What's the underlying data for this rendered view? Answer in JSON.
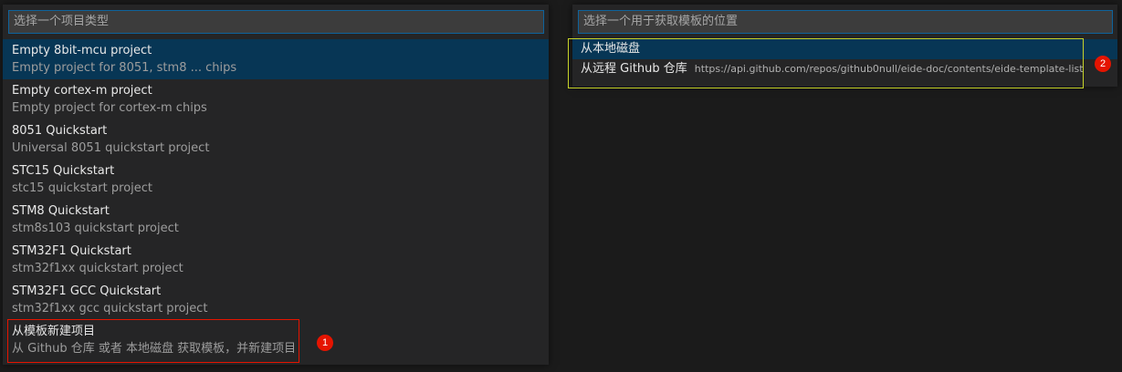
{
  "left_picker": {
    "placeholder": "选择一个项目类型",
    "items": [
      {
        "label": "Empty 8bit-mcu project",
        "description": "Empty project for 8051, stm8 ... chips"
      },
      {
        "label": "Empty cortex-m project",
        "description": "Empty project for cortex-m chips"
      },
      {
        "label": "8051 Quickstart",
        "description": "Universal 8051 quickstart project"
      },
      {
        "label": "STC15 Quickstart",
        "description": "stc15 quickstart project"
      },
      {
        "label": "STM8 Quickstart",
        "description": "stm8s103 quickstart project"
      },
      {
        "label": "STM32F1 Quickstart",
        "description": "stm32f1xx quickstart project"
      },
      {
        "label": "STM32F1 GCC Quickstart",
        "description": "stm32f1xx gcc quickstart project"
      },
      {
        "label": "从模板新建项目",
        "description": "从 Github 仓库 或者 本地磁盘 获取模板，并新建项目"
      }
    ]
  },
  "right_picker": {
    "placeholder": "选择一个用于获取模板的位置",
    "items": [
      {
        "label": "从本地磁盘",
        "detail": ""
      },
      {
        "label": "从远程 Github 仓库",
        "detail": "https://api.github.com/repos/github0null/eide-doc/contents/eide-template-list"
      }
    ]
  },
  "annotations": {
    "badge_1": "1",
    "badge_2": "2"
  },
  "colors": {
    "selection": "#073655",
    "input_border": "#0e639c",
    "annot_red": "#e51400",
    "annot_yellow": "#c7d32a"
  }
}
